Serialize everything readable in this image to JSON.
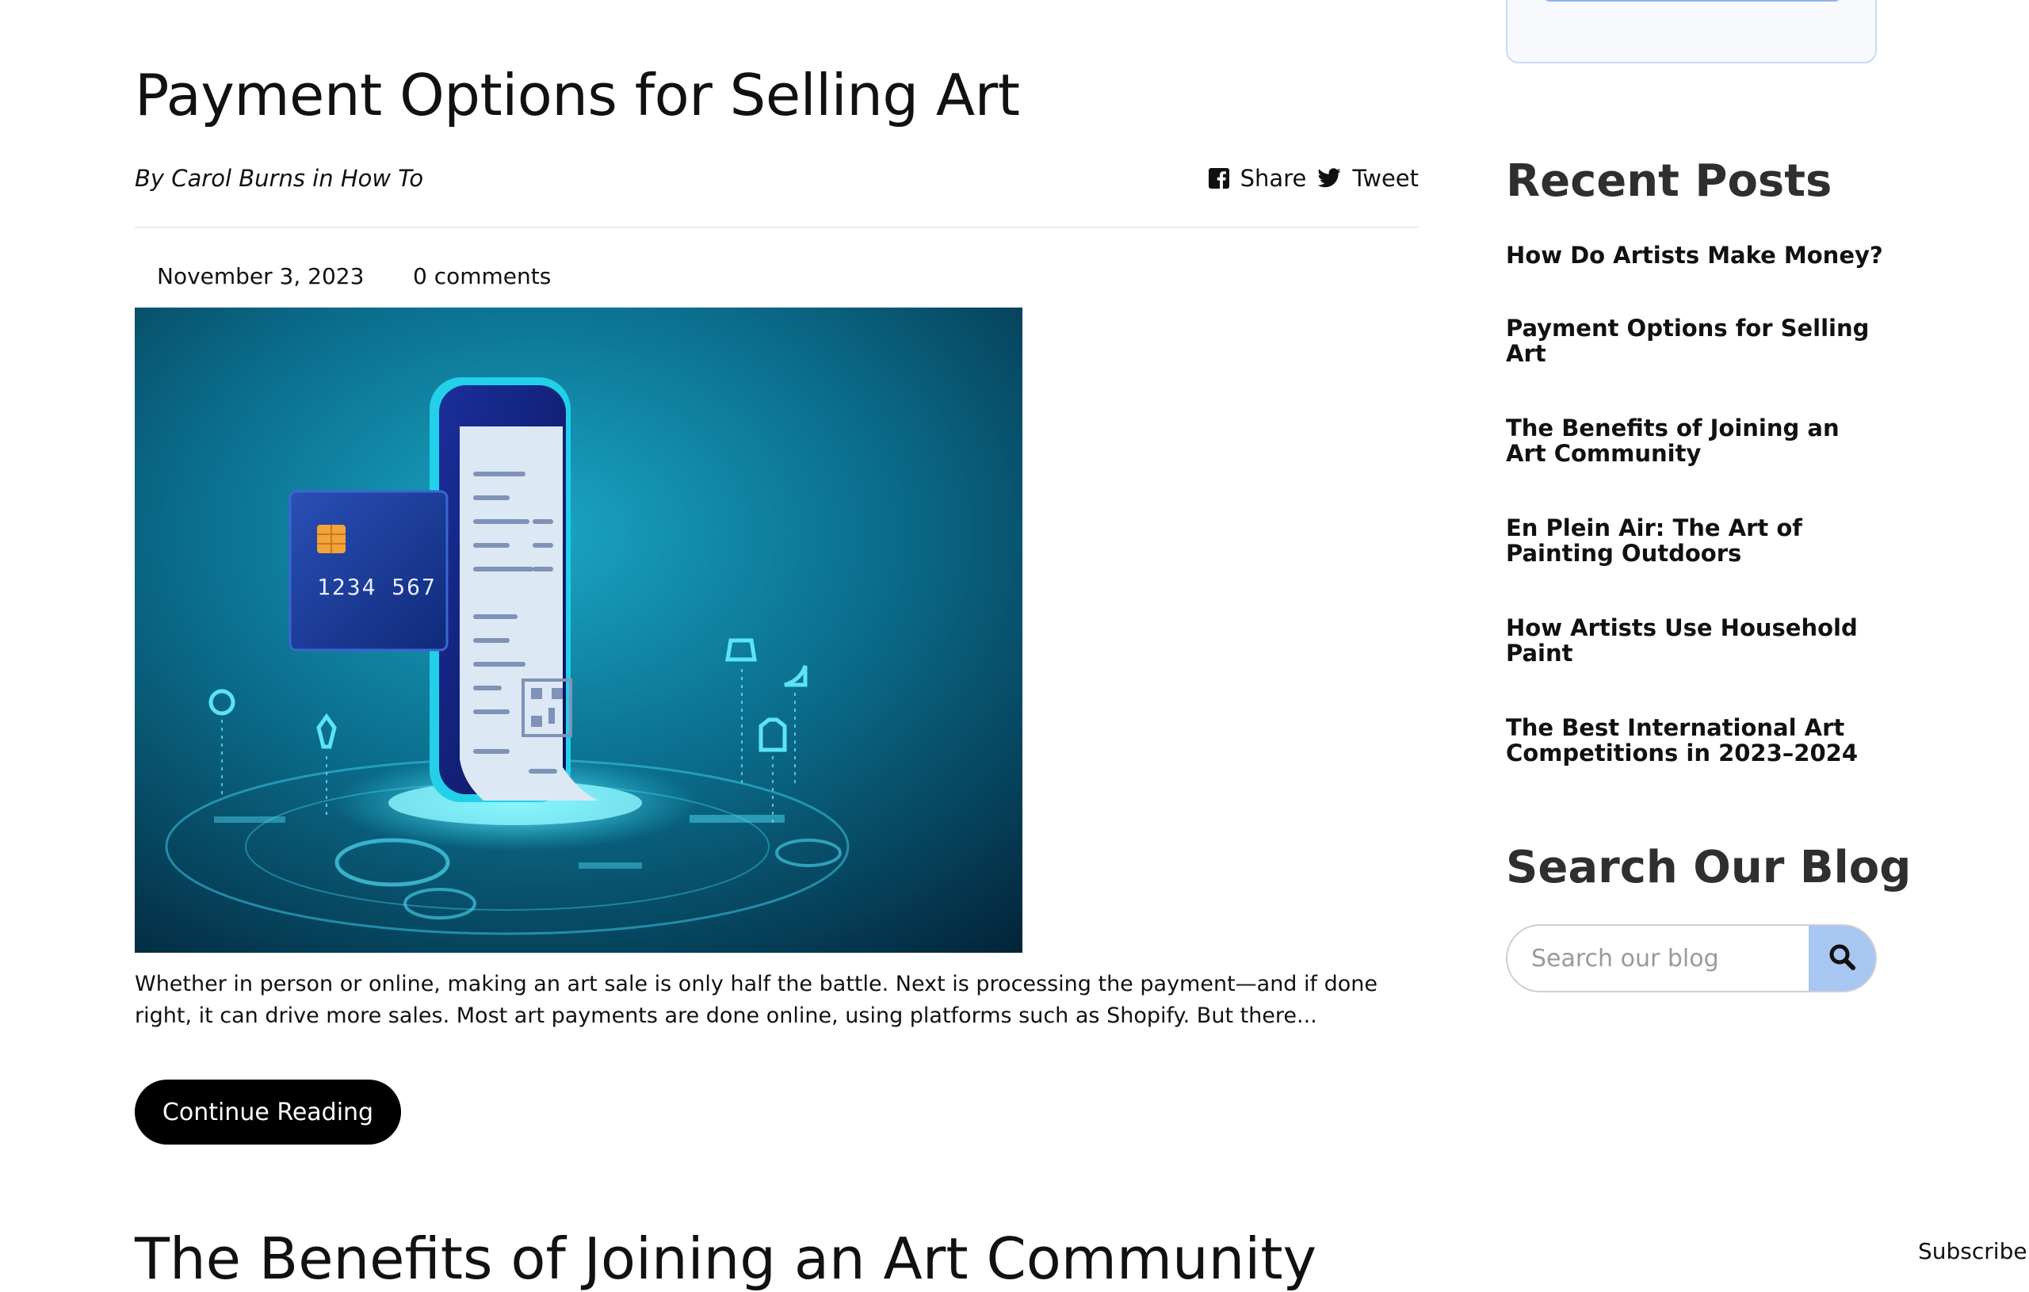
{
  "post": {
    "title": "Payment Options for Selling Art",
    "byline_prefix": "By",
    "author": "Carol Burns",
    "byline_in": "in",
    "category": "How To",
    "date": "November 3, 2023",
    "comments": "0 comments",
    "image_card_number": "1234 567",
    "excerpt": "Whether in person or online, making an art sale is only half the battle. Next is processing the payment—and if done right, it can drive more sales. Most art payments are done online, using platforms such as Shopify. But there...",
    "continue_label": "Continue Reading"
  },
  "social": {
    "share_label": "Share",
    "tweet_label": "Tweet"
  },
  "next_post": {
    "title": "The Benefits of Joining an Art Community"
  },
  "sidebar": {
    "recent_heading": "Recent Posts",
    "recent_posts": [
      "How Do Artists Make Money?",
      "Payment Options for Selling Art",
      "The Benefits of Joining an Art Community",
      "En Plein Air: The Art of Painting Outdoors",
      "How Artists Use Household Paint",
      "The Best International Art Competitions in 2023–2024"
    ],
    "search_heading": "Search Our Blog",
    "search_placeholder": "Search our blog"
  },
  "footer": {
    "subscribe_label": "Subscribe!"
  },
  "colors": {
    "button_bg": "#000000",
    "search_button_bg": "#a8c6f2",
    "heading_gray": "#2f2f2f"
  },
  "icons": [
    "facebook-icon",
    "twitter-icon",
    "search-icon"
  ]
}
